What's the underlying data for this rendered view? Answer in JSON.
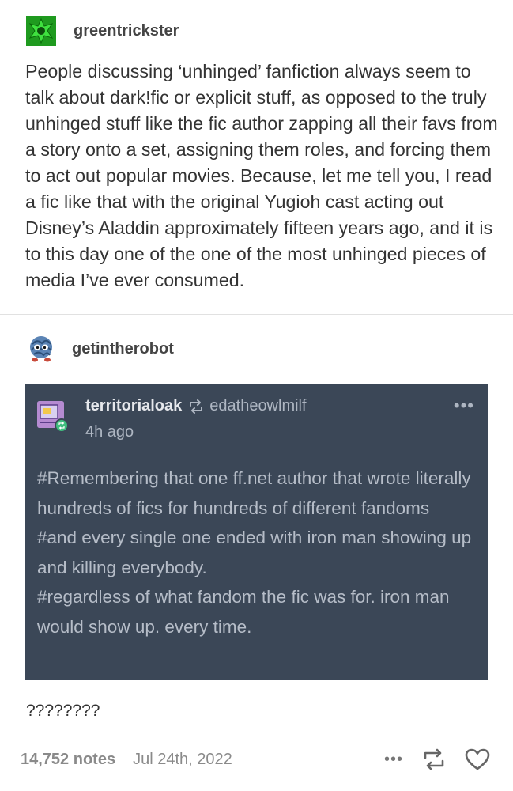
{
  "post1": {
    "username": "greentrickster",
    "avatar_icon": "green-star-avatar",
    "body": "People discussing ‘unhinged’ fanfiction always seem to talk about dark!fic or explicit stuff, as opposed to the truly unhinged stuff like the fic author zapping all their favs from a story onto a set, assigning them roles, and forcing them to act out popular movies. Because, let me tell you, I read a fic like that with the original Yugioh cast acting out Disney’s Aladdin approximately fifteen years ago, and it is to this day one of the one of the most unhinged pieces of media I’ve ever consumed."
  },
  "post2": {
    "username": "getintherobot",
    "avatar_icon": "tangela-avatar",
    "quote": {
      "username": "territorialoak",
      "reblog_icon": "reblog-icon",
      "source_username": "edatheowlmilf",
      "time": "4h ago",
      "more_label": "•••",
      "tags": [
        "#Remembering that one ff.net author that wrote literally hundreds of fics for hundreds of different fandoms",
        "#and every single one ended with iron man showing up and killing everybody.",
        "#regardless of what fandom the fic was for. iron man would show up. every time."
      ]
    },
    "reply": "????????"
  },
  "footer": {
    "notes": "14,752 notes",
    "date": "Jul 24th, 2022",
    "more_label": "•••"
  },
  "colors": {
    "quote_bg": "#3b4757",
    "tag_text": "#b6bdc8",
    "avatar_green": "#1f9a1f"
  }
}
